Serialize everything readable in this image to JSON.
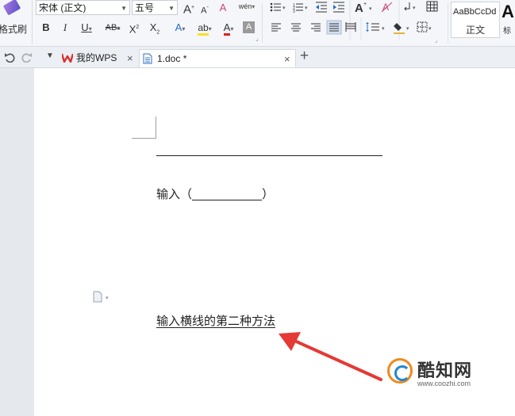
{
  "ribbon": {
    "format_painter_label": "格式刷",
    "font_name": "宋体 (正文)",
    "font_size": "五号",
    "grow_font": "A",
    "shrink_font": "A",
    "clear_format": "A",
    "phonetic": "wén",
    "bold": "B",
    "italic": "I",
    "underline": "U",
    "strikethrough": "AB",
    "superscript": "X",
    "subscript": "X",
    "text_effect": "A",
    "highlight": "ab",
    "font_color": "A",
    "char_shading": "A",
    "styles": {
      "normal_sample": "AaBbCcDd",
      "normal_name": "正文",
      "next_sample": "A",
      "next_name": "标"
    }
  },
  "tabs": [
    {
      "label": "我的WPS"
    },
    {
      "label": "1.doc *"
    }
  ],
  "document": {
    "line2_prefix": "输入（",
    "line2_suffix": "）",
    "underlined_text": "输入横线的第二种方法"
  },
  "watermark": {
    "brand": "酷知网",
    "url": "www.coozhi.com"
  },
  "colors": {
    "accent": "#2b579a",
    "arrow": "#e53935",
    "wps_red": "#d6322d"
  }
}
